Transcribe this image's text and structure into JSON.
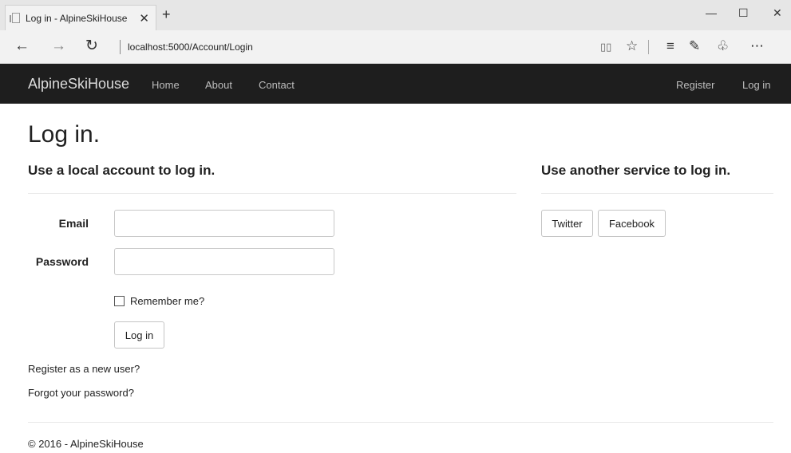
{
  "browser": {
    "tab_title": "Log in - AlpineSkiHouse",
    "tab_close": "✕",
    "new_tab": "+",
    "minimize": "—",
    "maximize": "☐",
    "close": "✕",
    "back": "←",
    "forward": "→",
    "refresh": "↻",
    "url": "localhost:5000/Account/Login",
    "reading_view": "▯▯",
    "favorite": "☆",
    "hub": "≡",
    "notes": "✎",
    "share": "♧",
    "more": "⋯"
  },
  "navbar": {
    "brand": "AlpineSkiHouse",
    "links": [
      "Home",
      "About",
      "Contact"
    ],
    "register": "Register",
    "login": "Log in"
  },
  "main": {
    "title": "Log in.",
    "local_heading": "Use a local account to log in.",
    "external_heading": "Use another service to log in.",
    "email_label": "Email",
    "email_value": "",
    "password_label": "Password",
    "password_value": "",
    "remember_label": "Remember me?",
    "remember_checked": false,
    "login_button": "Log in",
    "register_link": "Register as a new user?",
    "forgot_link": "Forgot your password?",
    "external_buttons": [
      "Twitter",
      "Facebook"
    ]
  },
  "footer": {
    "text": "© 2016 - AlpineSkiHouse"
  }
}
